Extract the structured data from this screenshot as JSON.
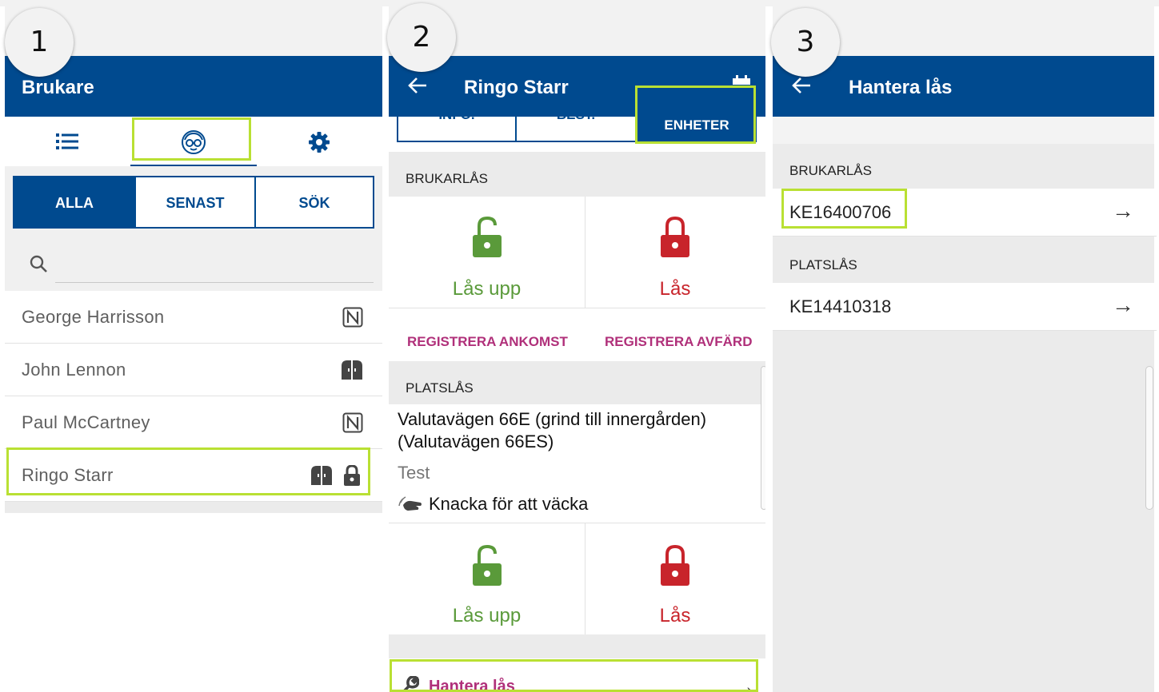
{
  "steps": [
    "1",
    "2",
    "3"
  ],
  "panel1": {
    "title": "Brukare",
    "icons": {
      "list": "list-icon",
      "senior": "senior-face-icon",
      "settings": "gear-icon",
      "search": "search-icon"
    },
    "filters": {
      "all": "ALLA",
      "recent": "SENAST",
      "search": "SÖK"
    },
    "search_placeholder": "",
    "users": [
      {
        "name": "George Harrisson",
        "icons": [
          "nfc-icon"
        ]
      },
      {
        "name": "John Lennon",
        "icons": [
          "door-icon"
        ]
      },
      {
        "name": "Paul McCartney",
        "icons": [
          "nfc-icon"
        ]
      },
      {
        "name": "Ringo Starr",
        "icons": [
          "door-icon",
          "lock-icon"
        ]
      }
    ]
  },
  "panel2": {
    "title": "Ringo Starr",
    "tabs": {
      "info": "INFO.",
      "best": "BEST.",
      "units": "ENHETER"
    },
    "user_locks_header": "BRUKARLÅS",
    "unlock_label": "Lås upp",
    "lock_label": "Lås",
    "register_arrival": "REGISTRERA ANKOMST",
    "register_departure": "REGISTRERA AVFÄRD",
    "site_locks_header": "PLATSLÅS",
    "site_address": "Valutavägen 66E (grind till innergården) (Valutavägen 66ES)",
    "site_note": "Test",
    "knock_label": "Knacka för att väcka",
    "manage_locks": "Hantera lås"
  },
  "panel3": {
    "title": "Hantera lås",
    "user_locks_header": "BRUKARLÅS",
    "user_lock_id": "KE16400706",
    "site_locks_header": "PLATSLÅS",
    "site_lock_id": "KE14410318"
  },
  "colors": {
    "primary": "#004a8f",
    "highlight": "#b9e033",
    "unlock_green": "#5a9a3a",
    "lock_red": "#c8242b",
    "link_magenta": "#b0307a"
  }
}
